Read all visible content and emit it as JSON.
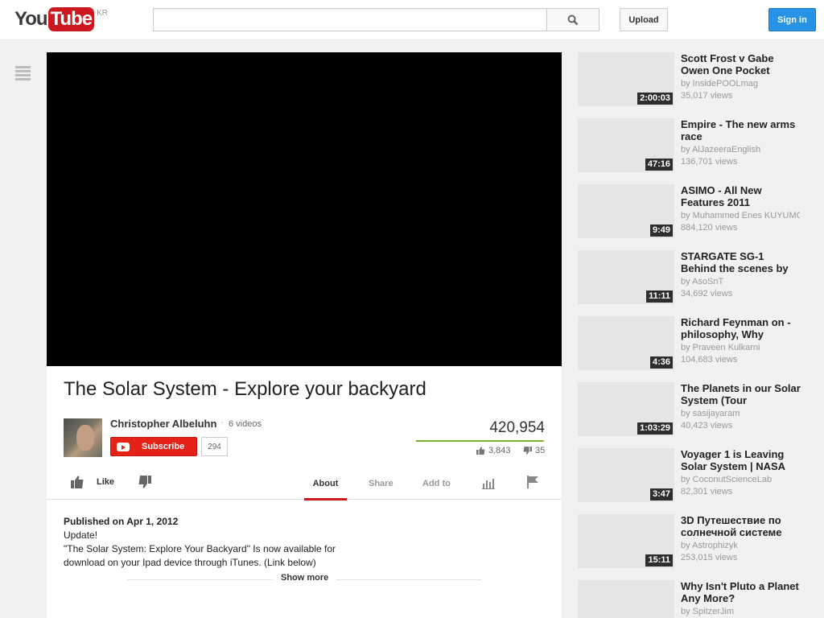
{
  "masthead": {
    "logo_you": "You",
    "logo_tube": "Tube",
    "region": "KR",
    "search_placeholder": "",
    "upload_label": "Upload",
    "signin_label": "Sign in"
  },
  "video": {
    "title": "The Solar System - Explore your backyard",
    "channel": "Christopher Albeluhn",
    "video_count": "6 videos",
    "subscribe_label": "Subscribe",
    "subscriber_count": "294",
    "views": "420,954",
    "like_ratio": 0.99,
    "likes": "3,843",
    "dislikes": "35"
  },
  "actions": {
    "like_label": "Like",
    "tabs": [
      "About",
      "Share",
      "Add to"
    ]
  },
  "description": {
    "published": "Published on Apr 1, 2012",
    "lines": [
      "Update!",
      "\"The Solar System: Explore Your Backyard\" Is now available for",
      "download on your Ipad device through iTunes. (Link below)"
    ],
    "show_more": "Show more"
  },
  "related": [
    {
      "title": "Scott Frost v Gabe Owen One Pocket",
      "by": "by InsidePOOLmag",
      "views": "35,017 views",
      "duration": "2:00:03"
    },
    {
      "title": "Empire - The new arms race",
      "by": "by AlJazeeraEnglish",
      "views": "136,701 views",
      "duration": "47:16"
    },
    {
      "title": "ASIMO - All New Features 2011",
      "by": "by Muhammed Enes KUYUMCU",
      "views": "884,120 views",
      "duration": "9:49"
    },
    {
      "title": "STARGATE SG-1 Behind the scenes by",
      "by": "by AsoSnT",
      "views": "34,692 views",
      "duration": "11:11"
    },
    {
      "title": "Richard Feynman on - philosophy, Why",
      "by": "by Praveen Kulkarni",
      "views": "104,683 views",
      "duration": "4:36"
    },
    {
      "title": "The Planets in our Solar System (Tour",
      "by": "by sasijayaram",
      "views": "40,423 views",
      "duration": "1:03:29"
    },
    {
      "title": "Voyager 1 is Leaving Solar System | NASA",
      "by": "by CoconutScienceLab",
      "views": "82,301 views",
      "duration": "3:47"
    },
    {
      "title": "3D Путешествие по солнечной системе",
      "by": "by Astrophizyk",
      "views": "253,015 views",
      "duration": "15:11"
    },
    {
      "title": "Why Isn't Pluto a Planet Any More?",
      "by": "by SpitzerJim",
      "views": "",
      "duration": ""
    }
  ]
}
